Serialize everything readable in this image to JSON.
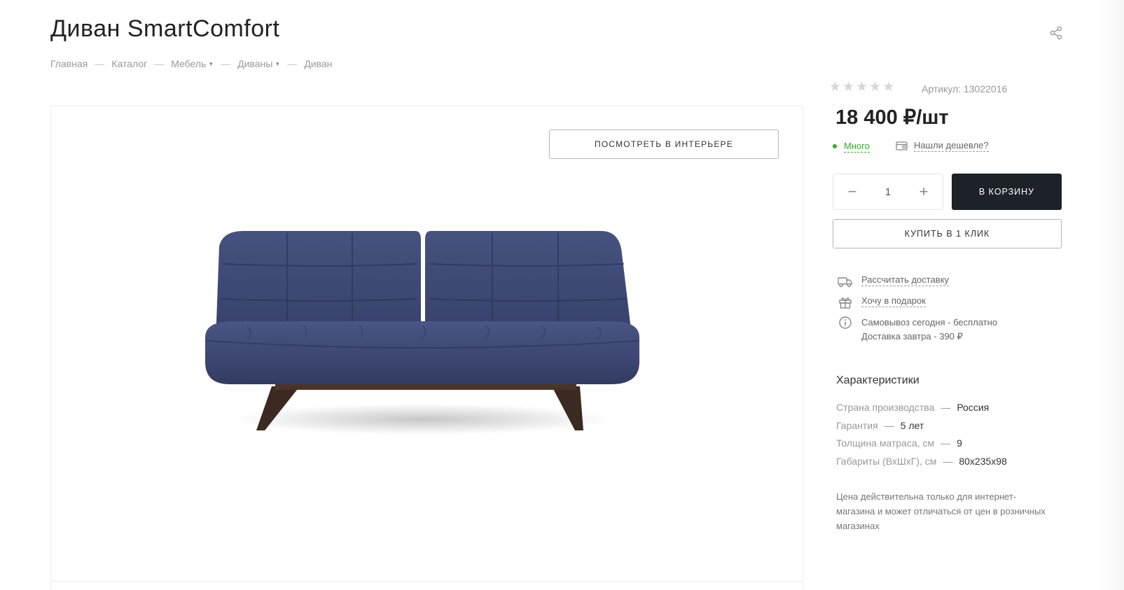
{
  "product": {
    "title": "Диван SmartComfort",
    "sku_text": "Артикул: 13022016",
    "price": "18 400 ₽/шт",
    "rating": {
      "value": 0,
      "max": 5
    },
    "stock_label": "Много",
    "cheaper_label": "Нашли дешевле?"
  },
  "breadcrumb": [
    {
      "label": "Главная",
      "has_dropdown": false
    },
    {
      "label": "Каталог",
      "has_dropdown": false
    },
    {
      "label": "Мебель",
      "has_dropdown": true
    },
    {
      "label": "Диваны",
      "has_dropdown": true
    },
    {
      "label": "Диван",
      "has_dropdown": false
    }
  ],
  "breadcrumb_sep": "—",
  "gallery": {
    "interior_button": "ПОСМОТРЕТЬ В ИНТЕРЬЕРЕ"
  },
  "purchase": {
    "quantity": "1",
    "minus_label": "−",
    "plus_label": "+",
    "cart_button": "В КОРЗИНУ",
    "one_click_button": "КУПИТЬ В 1 КЛИК"
  },
  "delivery": {
    "calc_label": "Рассчитать доставку",
    "gift_label": "Хочу в подарок",
    "pickup_line": "Самовывоз сегодня - бесплатно",
    "delivery_line": "Доставка завтра - 390 ₽"
  },
  "characteristics": {
    "title": "Характеристики",
    "separator": "—",
    "items": [
      {
        "name": "Страна производства",
        "value": "Россия"
      },
      {
        "name": "Гарантия",
        "value": "5 лет"
      },
      {
        "name": "Толщина матраса, см",
        "value": "9"
      },
      {
        "name": "Габариты (ВхШхГ), см",
        "value": "80x235x98"
      }
    ]
  },
  "note": "Цена действительна только для интернет-магазина и может отличаться от цен в розничных магазинах",
  "icons": {
    "share": "share-icon",
    "star": "star-icon",
    "wallet": "wallet-icon",
    "truck": "truck-icon",
    "gift": "gift-icon",
    "info": "info-icon"
  },
  "colors": {
    "accent_dark": "#1d2228",
    "in_stock": "#36a82a",
    "sofa_fabric": "#3f4a78",
    "sofa_legs": "#3b2a22"
  }
}
